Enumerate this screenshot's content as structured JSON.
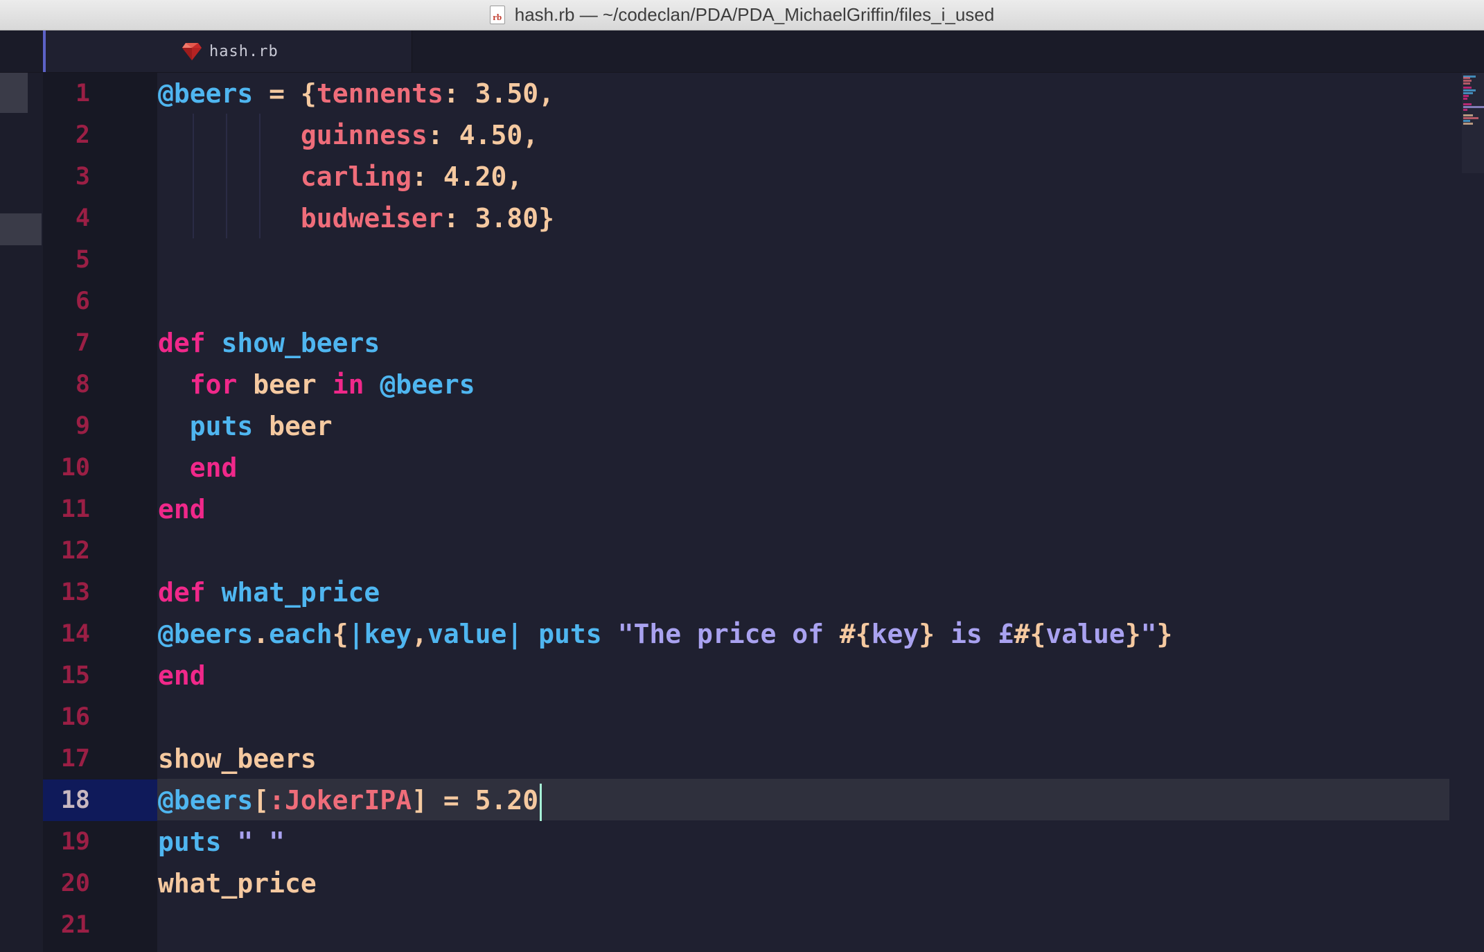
{
  "window": {
    "title": "hash.rb — ~/codeclan/PDA/PDA_MichaelGriffin/files_i_used",
    "doc_icon_text": "rb"
  },
  "tabs": [
    {
      "label": "hash.rb",
      "icon": "ruby-icon",
      "active": true
    }
  ],
  "editor": {
    "active_line": 18,
    "line_numbers": [
      "1",
      "2",
      "3",
      "4",
      "5",
      "6",
      "7",
      "8",
      "9",
      "10",
      "11",
      "12",
      "13",
      "14",
      "15",
      "16",
      "17",
      "18",
      "19",
      "20",
      "21"
    ],
    "lines": [
      [
        [
          "ivar",
          "@beers"
        ],
        [
          "op",
          " = "
        ],
        [
          "punc",
          "{"
        ],
        [
          "sym",
          "tennents"
        ],
        [
          "punc",
          ": "
        ],
        [
          "num",
          "3.50"
        ],
        [
          "punc",
          ","
        ]
      ],
      [
        [
          "plain",
          "         "
        ],
        [
          "sym",
          "guinness"
        ],
        [
          "punc",
          ": "
        ],
        [
          "num",
          "4.50"
        ],
        [
          "punc",
          ","
        ]
      ],
      [
        [
          "plain",
          "         "
        ],
        [
          "sym",
          "carling"
        ],
        [
          "punc",
          ": "
        ],
        [
          "num",
          "4.20"
        ],
        [
          "punc",
          ","
        ]
      ],
      [
        [
          "plain",
          "         "
        ],
        [
          "sym",
          "budweiser"
        ],
        [
          "punc",
          ": "
        ],
        [
          "num",
          "3.80"
        ],
        [
          "punc",
          "}"
        ]
      ],
      [],
      [],
      [
        [
          "kw",
          "def"
        ],
        [
          "plain",
          " "
        ],
        [
          "fn",
          "show_beers"
        ]
      ],
      [
        [
          "plain",
          "  "
        ],
        [
          "kw",
          "for"
        ],
        [
          "var",
          " beer "
        ],
        [
          "kw",
          "in"
        ],
        [
          "plain",
          " "
        ],
        [
          "ivar",
          "@beers"
        ]
      ],
      [
        [
          "plain",
          "  "
        ],
        [
          "fn",
          "puts"
        ],
        [
          "var",
          " beer"
        ]
      ],
      [
        [
          "plain",
          "  "
        ],
        [
          "kw",
          "end"
        ]
      ],
      [
        [
          "kw",
          "end"
        ]
      ],
      [],
      [
        [
          "kw",
          "def"
        ],
        [
          "plain",
          " "
        ],
        [
          "fn",
          "what_price"
        ]
      ],
      [
        [
          "ivar",
          "@beers"
        ],
        [
          "punc",
          "."
        ],
        [
          "fn",
          "each"
        ],
        [
          "punc",
          "{"
        ],
        [
          "pipe",
          "|"
        ],
        [
          "fn",
          "key"
        ],
        [
          "punc",
          ","
        ],
        [
          "fn",
          "value"
        ],
        [
          "pipe",
          "|"
        ],
        [
          "plain",
          " "
        ],
        [
          "fn",
          "puts"
        ],
        [
          "plain",
          " "
        ],
        [
          "str",
          "\"The price of "
        ],
        [
          "interp",
          "#{"
        ],
        [
          "str",
          "key"
        ],
        [
          "interp",
          "}"
        ],
        [
          "str",
          " is £"
        ],
        [
          "interp",
          "#{"
        ],
        [
          "str",
          "value"
        ],
        [
          "interp",
          "}"
        ],
        [
          "str",
          "\""
        ],
        [
          "punc",
          "}"
        ]
      ],
      [
        [
          "kw",
          "end"
        ]
      ],
      [],
      [
        [
          "var",
          "show_beers"
        ]
      ],
      [
        [
          "ivar",
          "@beers"
        ],
        [
          "punc",
          "["
        ],
        [
          "sym",
          ":JokerIPA"
        ],
        [
          "punc",
          "]"
        ],
        [
          "op",
          " = "
        ],
        [
          "num",
          "5.20"
        ]
      ],
      [
        [
          "fn",
          "puts"
        ],
        [
          "plain",
          " "
        ],
        [
          "str",
          "\" \""
        ]
      ],
      [
        [
          "var",
          "what_price"
        ]
      ],
      []
    ]
  },
  "colors": {
    "background": "#1f2030",
    "gutter": "#171824",
    "line_number": "#9b1f45",
    "active_line_number_bg": "#0f1a5a",
    "keyword": "#f0288a",
    "function": "#4fb6f0",
    "symbol": "#ef6d7a",
    "number": "#f5c9a0",
    "string": "#a9a2f0",
    "caret": "#a6f0d6"
  }
}
